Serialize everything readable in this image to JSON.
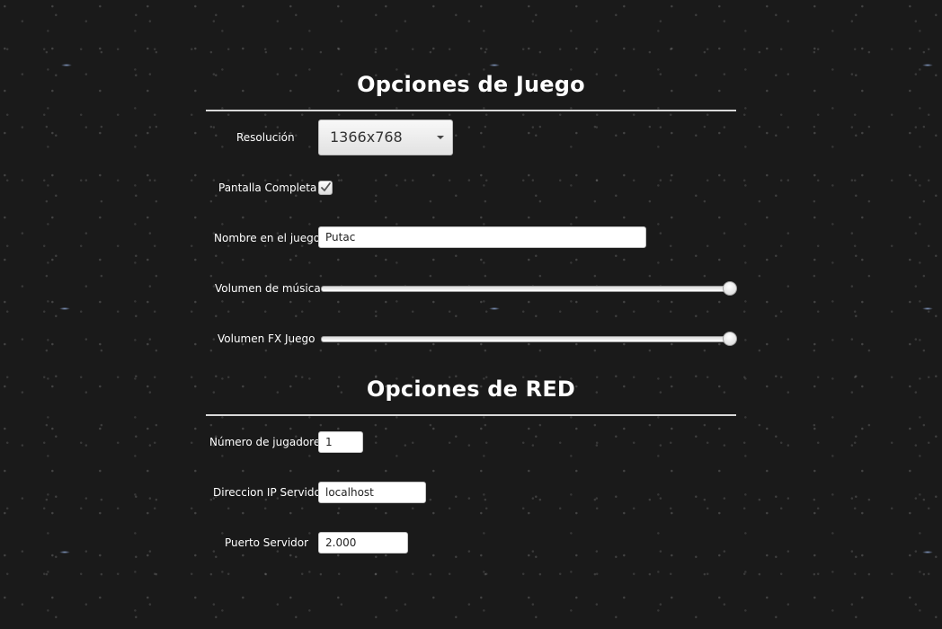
{
  "game_options": {
    "title": "Opciones de Juego",
    "resolution": {
      "label": "Resolución",
      "selected": "1366x768"
    },
    "fullscreen": {
      "label": "Pantalla Completa",
      "checked": true
    },
    "player_name": {
      "label": "Nombre en el juego",
      "value": "Putac"
    },
    "music_volume": {
      "label": "Volumen de música",
      "level": 1.0
    },
    "fx_volume": {
      "label": "Volumen FX Juego",
      "level": 1.0
    }
  },
  "network_options": {
    "title": "Opciones de RED",
    "num_players": {
      "label": "Número de jugadores",
      "value": "1"
    },
    "server_ip": {
      "label": "Direccion IP Servidor",
      "value": "localhost"
    },
    "server_port": {
      "label": "Puerto Servidor",
      "value": "2.000"
    }
  },
  "icons": {
    "dropdown": "chevron-down-icon",
    "check": "checkmark-icon"
  },
  "colors": {
    "background": "#1a1a1a",
    "text": "#ffffff",
    "divider": "#d8d8d8"
  }
}
